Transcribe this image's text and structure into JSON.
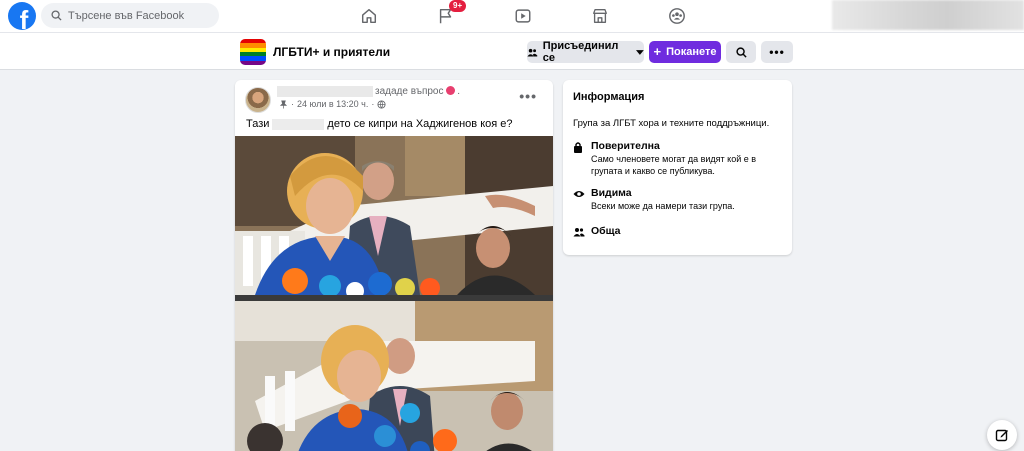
{
  "nav": {
    "logo_letter": "f",
    "search_placeholder": "Търсене във Facebook",
    "notifications_badge": "9+",
    "icons": [
      "home-icon",
      "flag-icon",
      "video-icon",
      "marketplace-icon",
      "groups-icon"
    ]
  },
  "group": {
    "name": "ЛГБТИ+ и приятели",
    "joined_label": "Присъединил се",
    "invite_label": "Поканете",
    "accent_color": "#6f2cdf"
  },
  "post": {
    "asked_text": "зададе въпрос",
    "asked_suffix": ".",
    "date": "24 юли в 13:20 ч.",
    "text_before": "Тази",
    "text_after": "дето се кипри на Хаджигенов коя е?"
  },
  "info": {
    "title": "Информация",
    "description": "Група за ЛГБТ хора и техните поддръжници.",
    "privacy_title": "Поверителна",
    "privacy_text_1": "Само членовете могат да видят кой е в",
    "privacy_text_2": "групата и какво се публикува.",
    "visible_title": "Видима",
    "visible_text": "Всеки може да намери тази група.",
    "general_title": "Обща"
  }
}
